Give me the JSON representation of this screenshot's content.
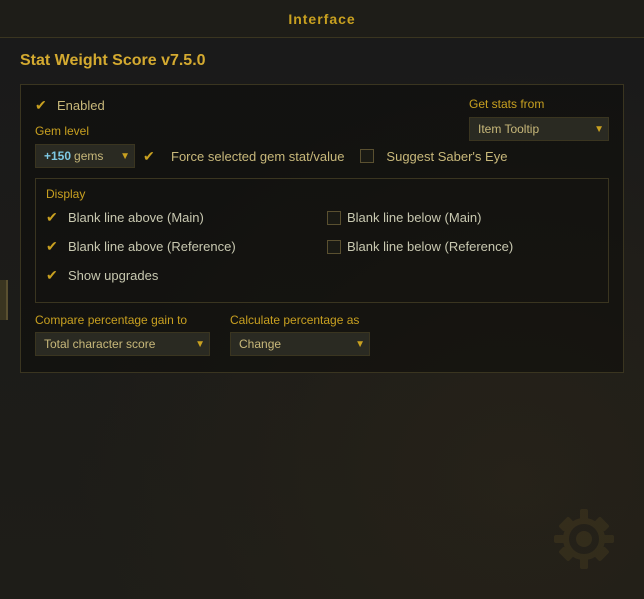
{
  "header": {
    "tab_label": "Interface"
  },
  "panel": {
    "title": "Stat Weight Score v7.5.0",
    "get_stats_from": {
      "label": "Get stats from",
      "selected": "Item Tooltip"
    },
    "enabled": {
      "label": "Enabled",
      "checked": true
    },
    "gem_level": {
      "label": "Gem level",
      "value": "+150",
      "unit": "gems",
      "force_label": "Force selected gem stat/value",
      "force_checked": true,
      "suggest_label": "Suggest Saber's Eye",
      "suggest_checked": false
    },
    "display": {
      "label": "Display",
      "checkboxes": [
        {
          "label": "Blank line above (Main)",
          "checked": true
        },
        {
          "label": "Blank line below (Main)",
          "checked": false
        },
        {
          "label": "Blank line above (Reference)",
          "checked": true
        },
        {
          "label": "Blank line below (Reference)",
          "checked": false
        }
      ],
      "show_upgrades": {
        "label": "Show upgrades",
        "checked": true
      }
    },
    "compare": {
      "label": "Compare percentage gain to",
      "selected": "Total character score"
    },
    "calculate": {
      "label": "Calculate percentage as",
      "selected": "Change"
    }
  }
}
